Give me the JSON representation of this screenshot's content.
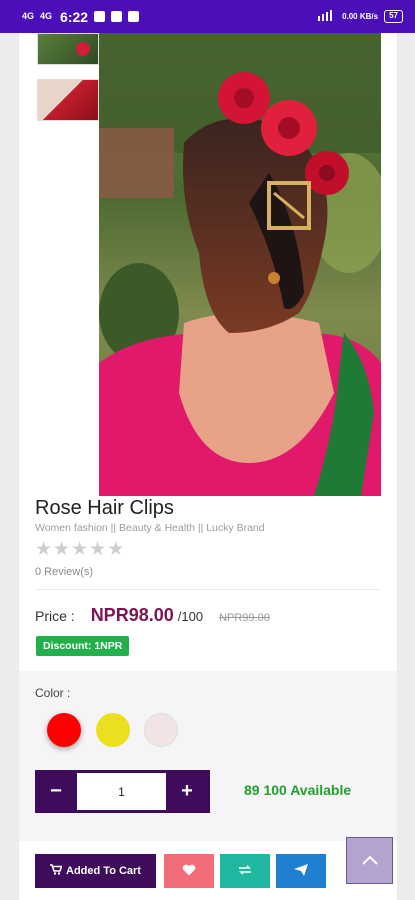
{
  "status_bar": {
    "network_1": "4G",
    "network_2": "4G",
    "time": "6:22",
    "speed": "0.00 KB/s",
    "battery": "57"
  },
  "product": {
    "title": "Rose Hair Clips",
    "categories": "Women fashion || Beauty & Health || Lucky Brand",
    "rating": 0,
    "max_rating": 5,
    "reviews": "0 Review(s)"
  },
  "pricing": {
    "label": "Price :",
    "price": "NPR98.00",
    "unit": "/100",
    "old_price": "NPR99.00",
    "discount": "Discount: 1NPR"
  },
  "options": {
    "color_label": "Color :",
    "colors": [
      "#ff0000",
      "#ebe01f",
      "#f2e4e4"
    ],
    "selected_color": "#ff0000"
  },
  "quantity": {
    "minus": "−",
    "value": "1",
    "plus": "+",
    "available": "89 100 Available"
  },
  "actions": {
    "cart_label": "Added To Cart"
  },
  "colors": {
    "status_bar": "#4a0fb8",
    "primary": "#3e0c5a",
    "price": "#7b1552",
    "discount": "#21b04b",
    "available": "#22a02b",
    "wishlist": "#f36c79",
    "compare": "#20b7a1",
    "share": "#1f7fd1"
  }
}
